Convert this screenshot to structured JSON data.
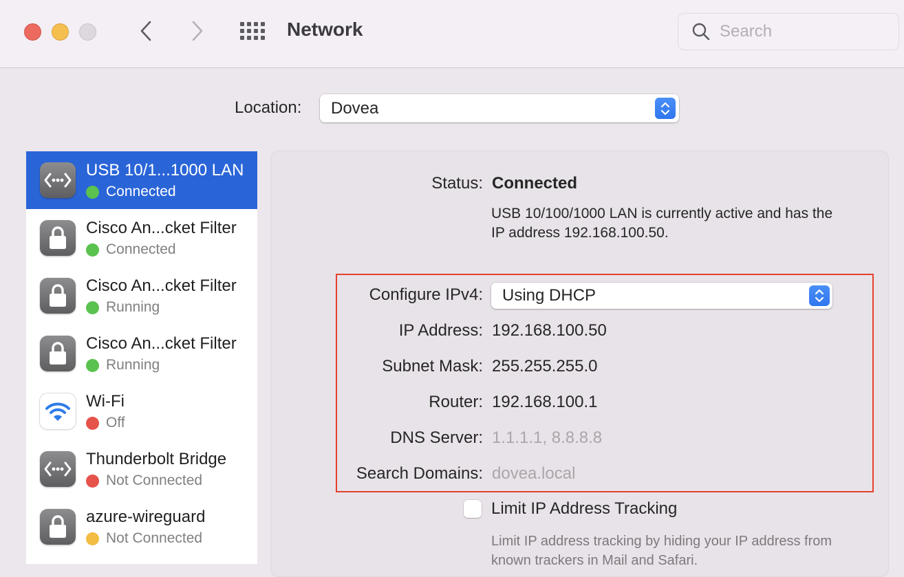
{
  "window": {
    "title": "Network",
    "search_placeholder": "Search",
    "search_value": ""
  },
  "location": {
    "label": "Location:",
    "value": "Dovea"
  },
  "services": [
    {
      "name": "USB 10/1...1000 LAN",
      "status": "Connected",
      "status_color": "#5ac24e",
      "icon": "ethernet-icon",
      "selected": true
    },
    {
      "name": "Cisco An...cket Filter",
      "status": "Connected",
      "status_color": "#5ac24e",
      "icon": "lock-icon",
      "selected": false
    },
    {
      "name": "Cisco An...cket Filter",
      "status": "Running",
      "status_color": "#5ac24e",
      "icon": "lock-icon",
      "selected": false
    },
    {
      "name": "Cisco An...cket Filter",
      "status": "Running",
      "status_color": "#5ac24e",
      "icon": "lock-icon",
      "selected": false
    },
    {
      "name": "Wi-Fi",
      "status": "Off",
      "status_color": "#e5534b",
      "icon": "wifi-icon",
      "selected": false
    },
    {
      "name": "Thunderbolt Bridge",
      "status": "Not Connected",
      "status_color": "#e5534b",
      "icon": "ethernet-icon",
      "selected": false
    },
    {
      "name": "azure-wireguard",
      "status": "Not Connected",
      "status_color": "#f3bc42",
      "icon": "lock-icon",
      "selected": false
    }
  ],
  "detail": {
    "status_label": "Status:",
    "status_value": "Connected",
    "status_description": "USB 10/100/1000 LAN is currently active and has the IP address 192.168.100.50.",
    "configure_ipv4_label": "Configure IPv4:",
    "configure_ipv4_value": "Using DHCP",
    "ip_address_label": "IP Address:",
    "ip_address_value": "192.168.100.50",
    "subnet_mask_label": "Subnet Mask:",
    "subnet_mask_value": "255.255.255.0",
    "router_label": "Router:",
    "router_value": "192.168.100.1",
    "dns_server_label": "DNS Server:",
    "dns_server_value": "1.1.1.1, 8.8.8.8",
    "search_domains_label": "Search Domains:",
    "search_domains_value": "dovea.local",
    "limit_tracking_label": "Limit IP Address Tracking",
    "limit_tracking_checked": false,
    "limit_tracking_description": "Limit IP address tracking by hiding your IP address from known trackers in Mail and Safari."
  },
  "colors": {
    "selection": "#2a65d8",
    "highlight_box": "#e5412d",
    "accent": "#2f76ef"
  }
}
